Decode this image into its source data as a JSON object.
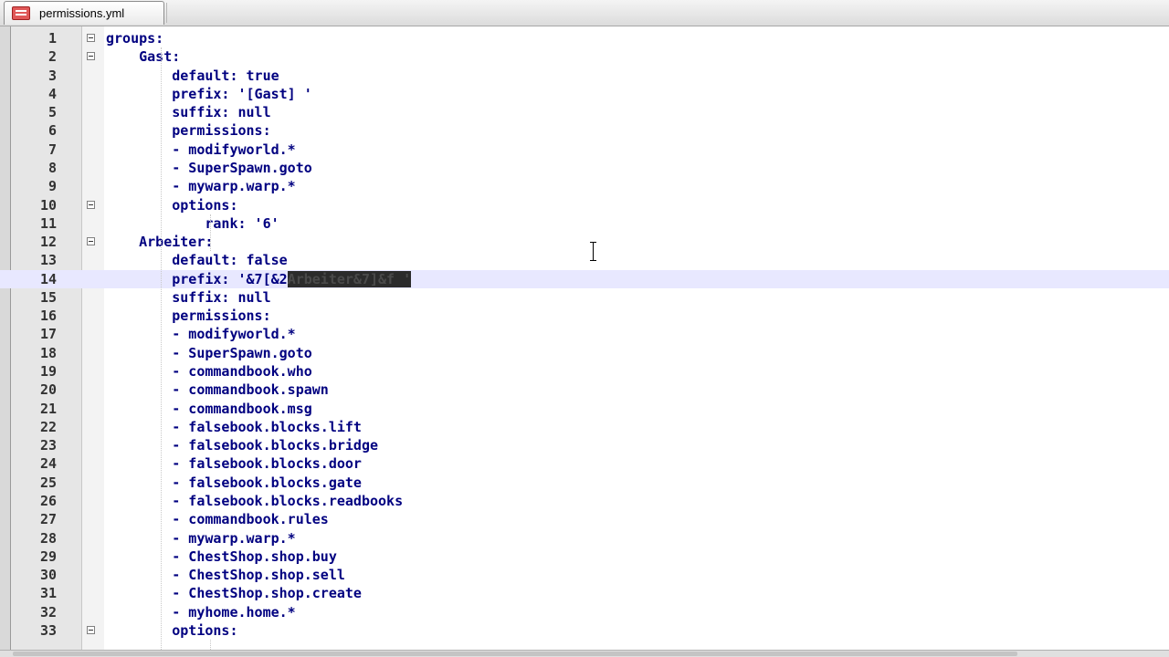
{
  "tab": {
    "filename": "permissions.yml",
    "icon": "yml-file-icon"
  },
  "editor": {
    "current_line": 14,
    "lines": [
      {
        "n": "1",
        "text": "groups:",
        "fold": true
      },
      {
        "n": "2",
        "text": "    Gast:",
        "fold": true
      },
      {
        "n": "3",
        "text": "        default: true"
      },
      {
        "n": "4",
        "text": "        prefix: '[Gast] '"
      },
      {
        "n": "5",
        "text": "        suffix: null"
      },
      {
        "n": "6",
        "text": "        permissions:"
      },
      {
        "n": "7",
        "text": "        - modifyworld.*"
      },
      {
        "n": "8",
        "text": "        - SuperSpawn.goto"
      },
      {
        "n": "9",
        "text": "        - mywarp.warp.*"
      },
      {
        "n": "10",
        "text": "        options:",
        "fold": true
      },
      {
        "n": "11",
        "text": "            rank: '6'"
      },
      {
        "n": "12",
        "text": "    Arbeiter:",
        "fold": true
      },
      {
        "n": "13",
        "text": "        default: false"
      },
      {
        "n": "14",
        "text": "        prefix: '&7[&2",
        "selected": "Arbeiter&7]&f '"
      },
      {
        "n": "15",
        "text": "        suffix: null"
      },
      {
        "n": "16",
        "text": "        permissions:"
      },
      {
        "n": "17",
        "text": "        - modifyworld.*"
      },
      {
        "n": "18",
        "text": "        - SuperSpawn.goto"
      },
      {
        "n": "19",
        "text": "        - commandbook.who"
      },
      {
        "n": "20",
        "text": "        - commandbook.spawn"
      },
      {
        "n": "21",
        "text": "        - commandbook.msg"
      },
      {
        "n": "22",
        "text": "        - falsebook.blocks.lift"
      },
      {
        "n": "23",
        "text": "        - falsebook.blocks.bridge"
      },
      {
        "n": "24",
        "text": "        - falsebook.blocks.door"
      },
      {
        "n": "25",
        "text": "        - falsebook.blocks.gate"
      },
      {
        "n": "26",
        "text": "        - falsebook.blocks.readbooks"
      },
      {
        "n": "27",
        "text": "        - commandbook.rules"
      },
      {
        "n": "28",
        "text": "        - mywarp.warp.*"
      },
      {
        "n": "29",
        "text": "        - ChestShop.shop.buy"
      },
      {
        "n": "30",
        "text": "        - ChestShop.shop.sell"
      },
      {
        "n": "31",
        "text": "        - ChestShop.shop.create"
      },
      {
        "n": "32",
        "text": "        - myhome.home.*"
      },
      {
        "n": "33",
        "text": "        options:",
        "fold": true
      }
    ]
  }
}
